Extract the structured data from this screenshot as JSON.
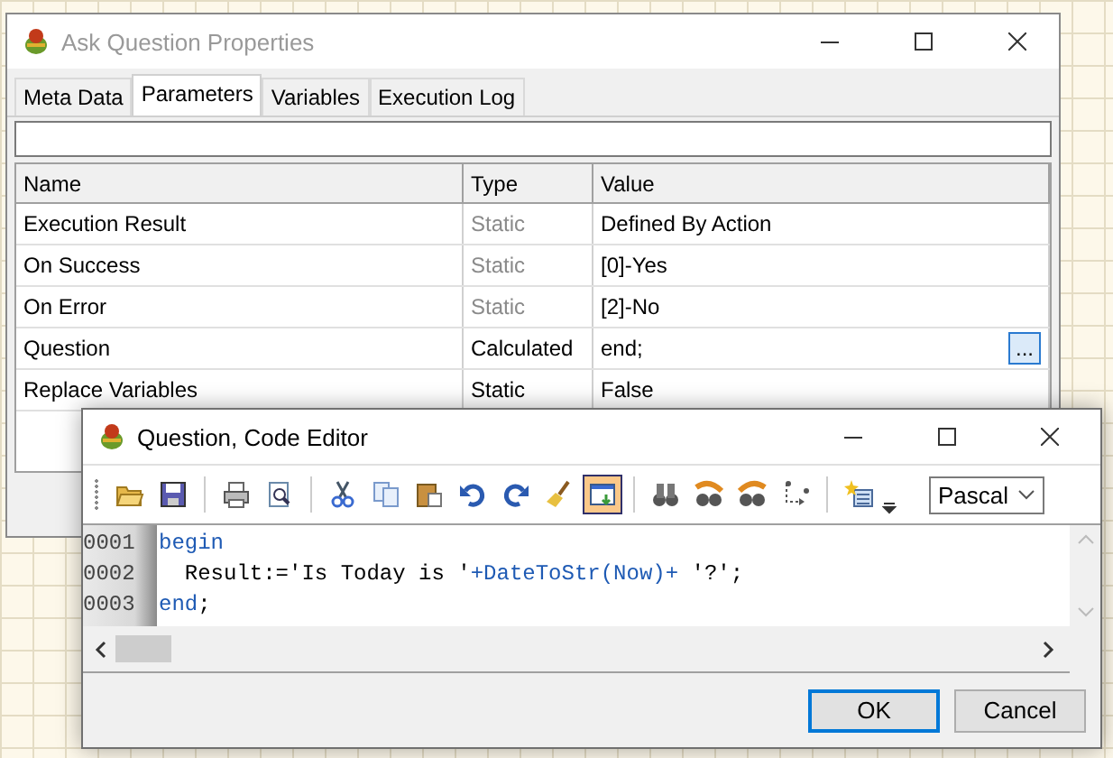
{
  "properties_window": {
    "title": "Ask Question Properties",
    "active": false,
    "tabs": [
      {
        "label": "Meta Data",
        "selected": false
      },
      {
        "label": "Parameters",
        "selected": true
      },
      {
        "label": "Variables",
        "selected": false
      },
      {
        "label": "Execution Log",
        "selected": false
      }
    ],
    "table": {
      "columns": [
        "Name",
        "Type",
        "Value"
      ],
      "rows": [
        {
          "name": "Execution Result",
          "type": "Static",
          "type_dimmed": true,
          "value": "Defined By Action"
        },
        {
          "name": "On Success",
          "type": "Static",
          "type_dimmed": true,
          "value": "[0]-Yes"
        },
        {
          "name": "On Error",
          "type": "Static",
          "type_dimmed": true,
          "value": "[2]-No"
        },
        {
          "name": "Question",
          "type": "Calculated",
          "type_dimmed": false,
          "value": "end;",
          "action": "..."
        },
        {
          "name": "Replace Variables",
          "type": "Static",
          "type_dimmed": false,
          "value": "False"
        }
      ]
    }
  },
  "editor_window": {
    "title": "Question, Code Editor",
    "active": true,
    "toolbar": [
      {
        "kind": "grip"
      },
      {
        "kind": "open",
        "pressed": false
      },
      {
        "kind": "save",
        "pressed": false
      },
      {
        "kind": "separator"
      },
      {
        "kind": "print",
        "pressed": false
      },
      {
        "kind": "preview",
        "pressed": false
      },
      {
        "kind": "separator"
      },
      {
        "kind": "cut",
        "pressed": false
      },
      {
        "kind": "copy",
        "pressed": false
      },
      {
        "kind": "paste",
        "pressed": false
      },
      {
        "kind": "undo",
        "pressed": false
      },
      {
        "kind": "redo",
        "pressed": false
      },
      {
        "kind": "broom",
        "pressed": false
      },
      {
        "kind": "pane",
        "pressed": true
      },
      {
        "kind": "separator"
      },
      {
        "kind": "find",
        "pressed": false
      },
      {
        "kind": "find-next",
        "pressed": false
      },
      {
        "kind": "find-previous",
        "pressed": false
      },
      {
        "kind": "goto",
        "pressed": false
      },
      {
        "kind": "separator"
      },
      {
        "kind": "bookmark",
        "pressed": false
      },
      {
        "kind": "more"
      }
    ],
    "language": "Pascal",
    "lines": [
      {
        "number": "0001",
        "tokens": [
          {
            "text": "begin",
            "kind": "keyword"
          }
        ]
      },
      {
        "number": "0002",
        "tokens": [
          {
            "text": "  Result:=",
            "kind": "plain"
          },
          {
            "text": "'Is Today is '",
            "kind": "string"
          },
          {
            "text": "+DateToStr(Now)+",
            "kind": "function"
          },
          {
            "text": " '?'",
            "kind": "string"
          },
          {
            "text": ";",
            "kind": "plain"
          }
        ]
      },
      {
        "number": "0003",
        "tokens": [
          {
            "text": "end",
            "kind": "keyword"
          },
          {
            "text": ";",
            "kind": "plain"
          }
        ]
      }
    ],
    "buttons": [
      {
        "label": "OK",
        "default": true
      },
      {
        "label": "Cancel",
        "default": false
      }
    ]
  }
}
